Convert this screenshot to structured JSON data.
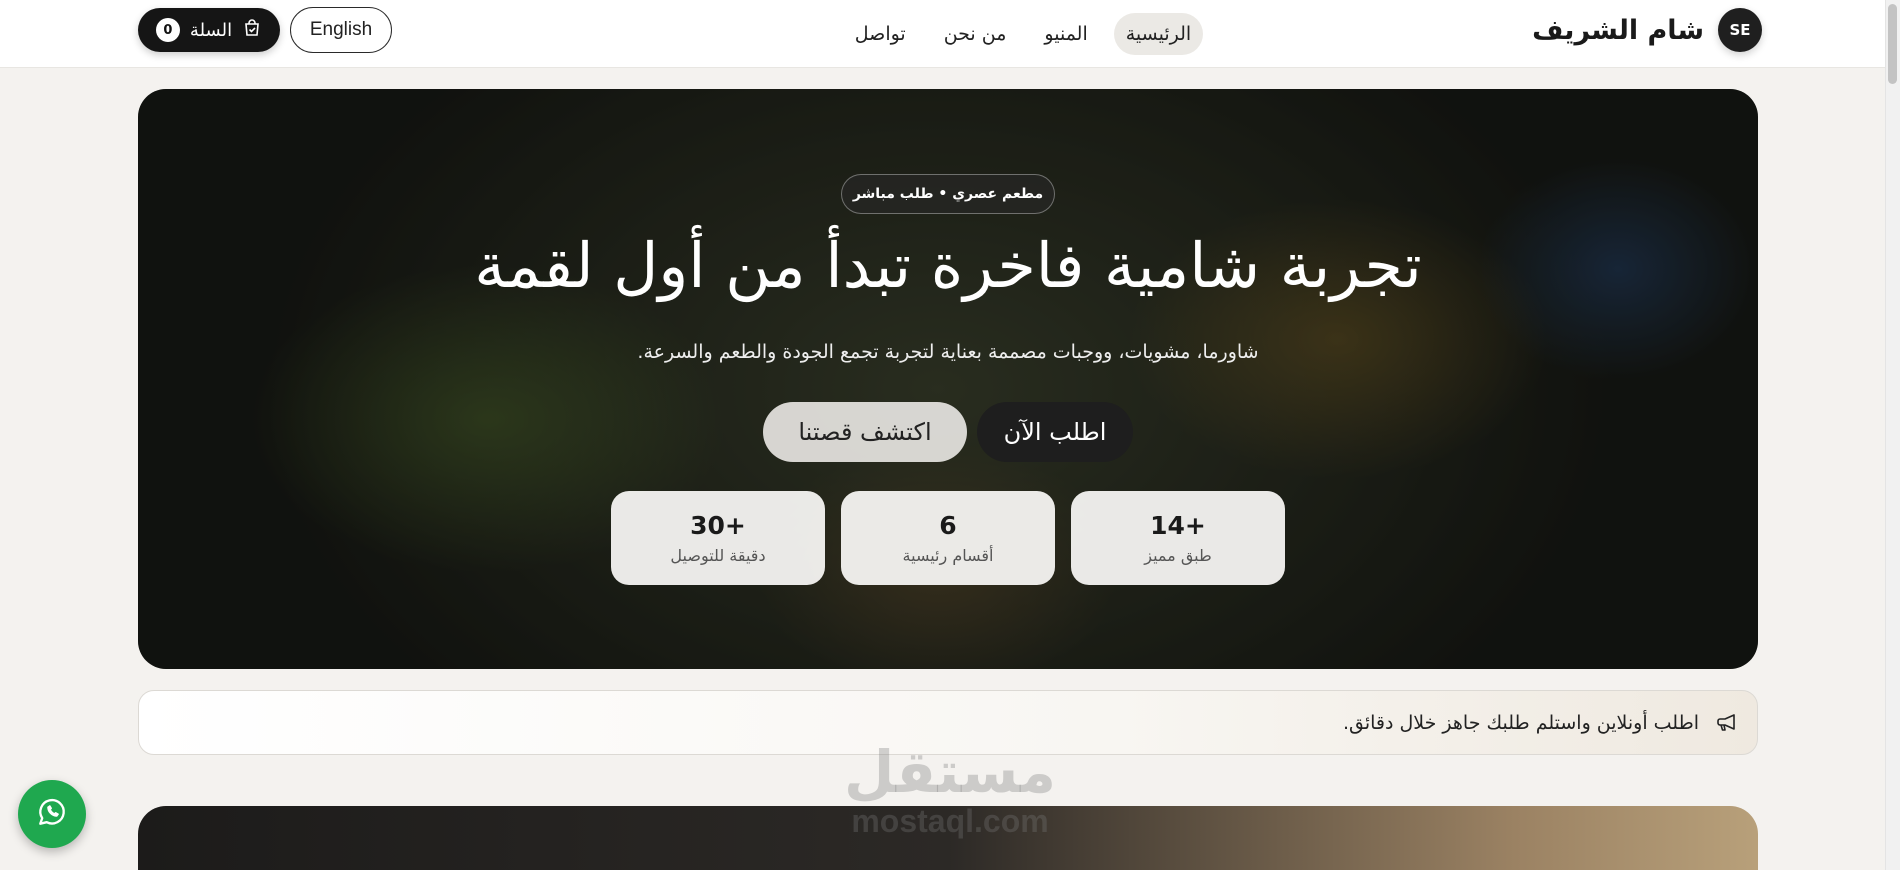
{
  "brand": {
    "initials": "SE",
    "name": "شام الشريف"
  },
  "nav": {
    "links": [
      {
        "label": "الرئيسية"
      },
      {
        "label": "المنيو"
      },
      {
        "label": "من نحن"
      },
      {
        "label": "تواصل"
      }
    ],
    "lang_label": "English",
    "cart_label": "السلة",
    "cart_count": "0"
  },
  "hero": {
    "badge": "مطعم عصري • طلب مباشر",
    "title": "تجربة شامية فاخرة تبدأ من أول لقمة",
    "subtitle": "شاورما، مشويات، ووجبات مصممة بعناية لتجربة تجمع الجودة والطعم والسرعة.",
    "primary_button": "اطلب الآن",
    "secondary_button": "اكتشف قصتنا",
    "stats": [
      {
        "value": "+14",
        "label": "طبق مميز"
      },
      {
        "value": "6",
        "label": "أقسام رئيسية"
      },
      {
        "value": "+30",
        "label": "دقيقة للتوصيل"
      }
    ]
  },
  "notice": {
    "text": "اطلب أونلاين واستلم طلبك جاهز خلال دقائق.",
    "icon": "megaphone-icon"
  },
  "watermark": {
    "arabic": "مستقل",
    "latin": "mostaql.com"
  },
  "floating": {
    "icon": "whatsapp-icon"
  },
  "colors": {
    "dark": "#151515",
    "whatsapp": "#1fa84f",
    "page_bg": "#f4f2ef"
  }
}
